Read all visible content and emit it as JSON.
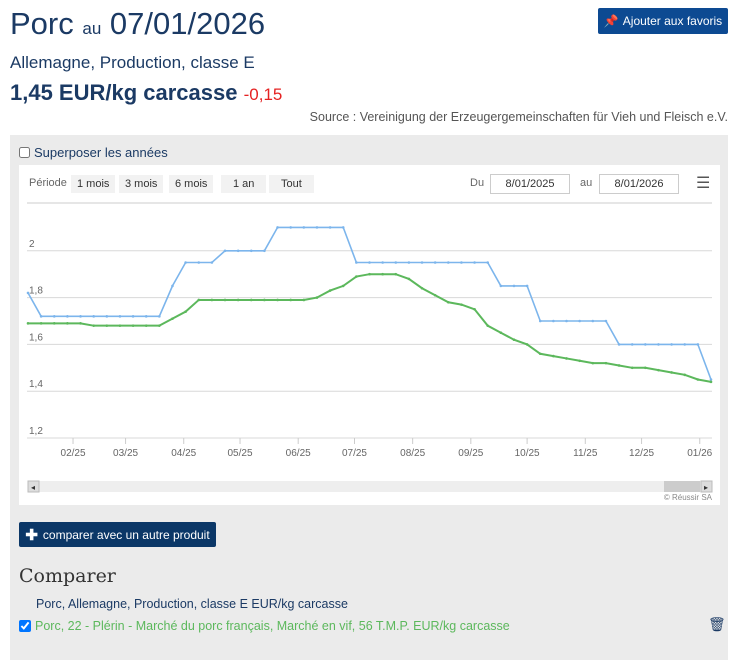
{
  "header": {
    "product": "Porc",
    "au": "au",
    "date": "07/01/2026",
    "favorite_label": "Ajouter aux favoris",
    "subtitle": "Allemagne, Production, classe E",
    "price": "1,45 EUR/kg carcasse",
    "change": "-0,15",
    "source": "Source : Vereinigung der Erzeugergemeinschaften für Vieh und Fleisch e.V."
  },
  "options": {
    "overlay_years_label": "Superposer les années",
    "overlay_years_checked": false
  },
  "range": {
    "period_label": "Période",
    "buttons": [
      "1 mois",
      "3 mois",
      "6 mois",
      "1 an",
      "Tout"
    ],
    "from_label": "Du",
    "from": "8/01/2025",
    "to_label": "au",
    "to": "8/01/2026",
    "menu_icon": "hamburger-icon"
  },
  "chart_data": {
    "type": "line",
    "title": "",
    "xlabel": "",
    "ylabel": "",
    "ylim": [
      1.2,
      2.2
    ],
    "yticks": [
      "1,2",
      "1,4",
      "1,6",
      "1,8",
      "2"
    ],
    "ytick_values": [
      1.2,
      1.4,
      1.6,
      1.8,
      2.0
    ],
    "xticks": [
      "02/25",
      "03/25",
      "04/25",
      "05/25",
      "06/25",
      "07/25",
      "08/25",
      "09/25",
      "10/25",
      "11/25",
      "12/25",
      "01/26"
    ],
    "xtick_dates": [
      "2025-02-01",
      "2025-03-01",
      "2025-04-01",
      "2025-05-01",
      "2025-06-01",
      "2025-07-01",
      "2025-08-01",
      "2025-09-01",
      "2025-10-01",
      "2025-11-01",
      "2025-12-01",
      "2026-01-01"
    ],
    "xlim": [
      "2025-01-08",
      "2026-01-07"
    ],
    "grid": true,
    "x": [
      "2025-01-08",
      "2025-01-15",
      "2025-01-22",
      "2025-01-29",
      "2025-02-05",
      "2025-02-12",
      "2025-02-19",
      "2025-02-26",
      "2025-03-05",
      "2025-03-12",
      "2025-03-19",
      "2025-03-26",
      "2025-04-02",
      "2025-04-09",
      "2025-04-16",
      "2025-04-23",
      "2025-04-30",
      "2025-05-07",
      "2025-05-14",
      "2025-05-21",
      "2025-05-28",
      "2025-06-04",
      "2025-06-11",
      "2025-06-18",
      "2025-06-25",
      "2025-07-02",
      "2025-07-09",
      "2025-07-16",
      "2025-07-23",
      "2025-07-30",
      "2025-08-06",
      "2025-08-13",
      "2025-08-20",
      "2025-08-27",
      "2025-09-03",
      "2025-09-10",
      "2025-09-17",
      "2025-09-24",
      "2025-10-01",
      "2025-10-08",
      "2025-10-15",
      "2025-10-22",
      "2025-10-29",
      "2025-11-05",
      "2025-11-12",
      "2025-11-19",
      "2025-11-26",
      "2025-12-03",
      "2025-12-10",
      "2025-12-17",
      "2025-12-24",
      "2025-12-31",
      "2026-01-07"
    ],
    "series": [
      {
        "color": "#7cb5ec",
        "values": [
          1.82,
          1.72,
          1.72,
          1.72,
          1.72,
          1.72,
          1.72,
          1.72,
          1.72,
          1.72,
          1.72,
          1.85,
          1.95,
          1.95,
          1.95,
          2.0,
          2.0,
          2.0,
          2.0,
          2.1,
          2.1,
          2.1,
          2.1,
          2.1,
          2.1,
          1.95,
          1.95,
          1.95,
          1.95,
          1.95,
          1.95,
          1.95,
          1.95,
          1.95,
          1.95,
          1.95,
          1.85,
          1.85,
          1.85,
          1.7,
          1.7,
          1.7,
          1.7,
          1.7,
          1.7,
          1.6,
          1.6,
          1.6,
          1.6,
          1.6,
          1.6,
          1.6,
          1.45
        ]
      },
      {
        "color": "#5cb85c",
        "values": [
          1.69,
          1.69,
          1.69,
          1.69,
          1.69,
          1.68,
          1.68,
          1.68,
          1.68,
          1.68,
          1.68,
          1.71,
          1.74,
          1.79,
          1.79,
          1.79,
          1.79,
          1.79,
          1.79,
          1.79,
          1.79,
          1.79,
          1.8,
          1.83,
          1.85,
          1.89,
          1.9,
          1.9,
          1.9,
          1.88,
          1.84,
          1.81,
          1.78,
          1.77,
          1.75,
          1.68,
          1.65,
          1.62,
          1.6,
          1.56,
          1.55,
          1.54,
          1.53,
          1.52,
          1.52,
          1.51,
          1.5,
          1.5,
          1.49,
          1.48,
          1.47,
          1.45,
          1.44
        ]
      }
    ],
    "credits": "© Réussir SA"
  },
  "compare": {
    "button_label": "comparer avec un autre produit",
    "title": "Comparer",
    "items": [
      {
        "label": "Porc, Allemagne, Production, classe E EUR/kg carcasse",
        "color": "#1b3a64"
      },
      {
        "label": "Porc, 22 - Plérin - Marché du porc français, Marché en vif, 56 T.M.P. EUR/kg carcasse",
        "color": "#5cb85c",
        "checked": true
      }
    ]
  }
}
